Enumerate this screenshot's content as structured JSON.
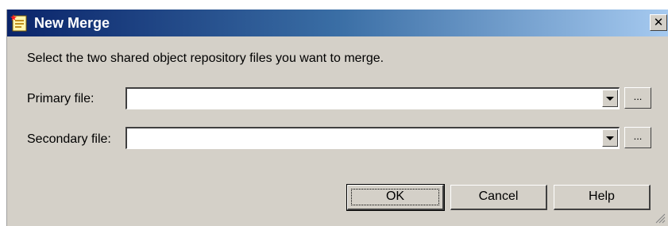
{
  "dialog": {
    "title": "New Merge",
    "close_icon": "close-icon",
    "instruction": "Select the two shared object repository files you want to merge."
  },
  "fields": {
    "primary": {
      "label": "Primary file:",
      "value": "",
      "browse_label": "..."
    },
    "secondary": {
      "label": "Secondary file:",
      "value": "",
      "browse_label": "..."
    }
  },
  "buttons": {
    "ok": "OK",
    "cancel": "Cancel",
    "help": "Help"
  },
  "colors": {
    "dialog_bg": "#d4d0c8",
    "titlebar_start": "#0a246a",
    "titlebar_end": "#a6caf0",
    "title_text": "#ffffff"
  }
}
